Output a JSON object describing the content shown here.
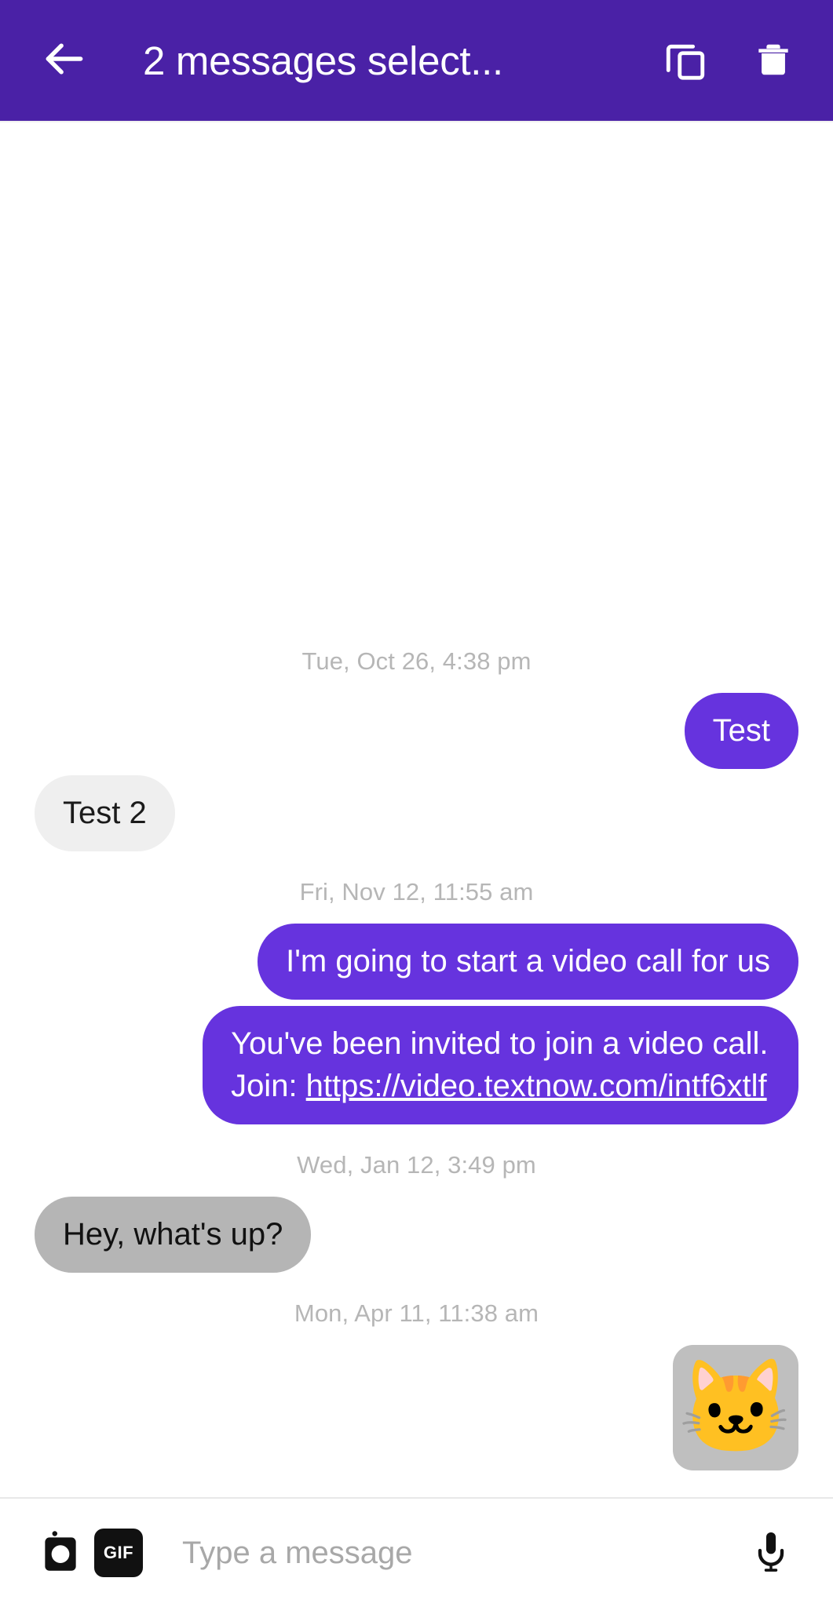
{
  "appbar": {
    "title": "2 messages select...",
    "back_icon": "arrow-left-icon",
    "copy_icon": "copy-icon",
    "delete_icon": "trash-icon",
    "background_color": "#4A21A6"
  },
  "colors": {
    "header_purple": "#4A21A6",
    "bubble_outgoing_purple": "#6633DE",
    "bubble_incoming_gray": "#EFEFEF",
    "bubble_selected_gray": "#B5B5B5",
    "timestamp_gray": "#B6B6B6",
    "sticker_background": "#BFBFBF"
  },
  "thread": {
    "groups": [
      {
        "timestamp": "Tue, Oct 26, 4:38 pm",
        "messages": [
          {
            "type": "text",
            "direction": "out",
            "selected": false,
            "text": "Test"
          },
          {
            "type": "text",
            "direction": "in",
            "selected": false,
            "text": "Test 2"
          }
        ]
      },
      {
        "timestamp": "Fri, Nov 12, 11:55 am",
        "messages": [
          {
            "type": "text",
            "direction": "out",
            "selected": false,
            "text": "I'm going to start a video call for us"
          },
          {
            "type": "link",
            "direction": "out",
            "selected": false,
            "text_before": "You've been invited to join a video call. Join: ",
            "link_text": "https://video.textnow.com/intf6xtlf"
          }
        ]
      },
      {
        "timestamp": "Wed, Jan 12, 3:49 pm",
        "messages": [
          {
            "type": "text",
            "direction": "in",
            "selected": true,
            "text": "Hey, what's up?"
          }
        ]
      },
      {
        "timestamp": "Mon, Apr 11, 11:38 am",
        "messages": [
          {
            "type": "sticker",
            "direction": "out",
            "selected": true,
            "glyph": "🐱",
            "name": "cat-face-sticker"
          }
        ]
      }
    ]
  },
  "composer": {
    "camera_icon": "camera-icon",
    "gif_label": "GIF",
    "placeholder": "Type a message",
    "value": "",
    "mic_icon": "microphone-icon"
  }
}
